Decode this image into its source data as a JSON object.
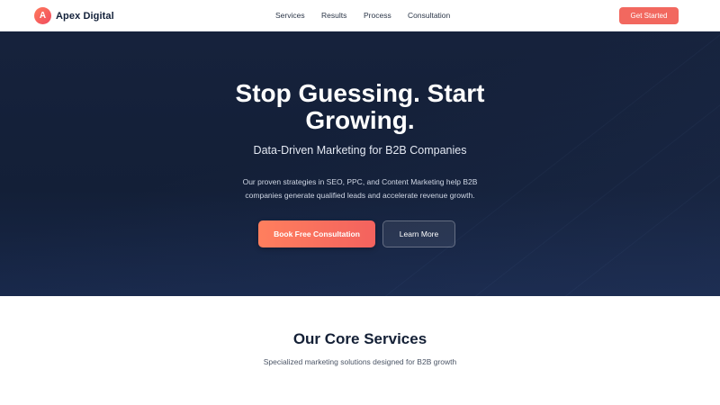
{
  "brand": {
    "logo_letter": "A",
    "name": "Apex Digital",
    "accent_color": "#f2685f"
  },
  "nav": {
    "links": [
      "Services",
      "Results",
      "Process",
      "Consultation"
    ],
    "cta_label": "Get Started"
  },
  "hero": {
    "title_line1": "Stop Guessing. Start",
    "title_line2": "Growing.",
    "subtitle": "Data-Driven Marketing for B2B Companies",
    "description_line1": "Our proven strategies in SEO, PPC, and Content Marketing help B2B",
    "description_line2": "companies generate qualified leads and accelerate revenue growth.",
    "primary_button": "Book Free Consultation",
    "secondary_button": "Learn More",
    "background_color": "#16223c"
  },
  "services": {
    "title": "Our Core Services",
    "subtitle": "Specialized marketing solutions designed for B2B growth"
  }
}
